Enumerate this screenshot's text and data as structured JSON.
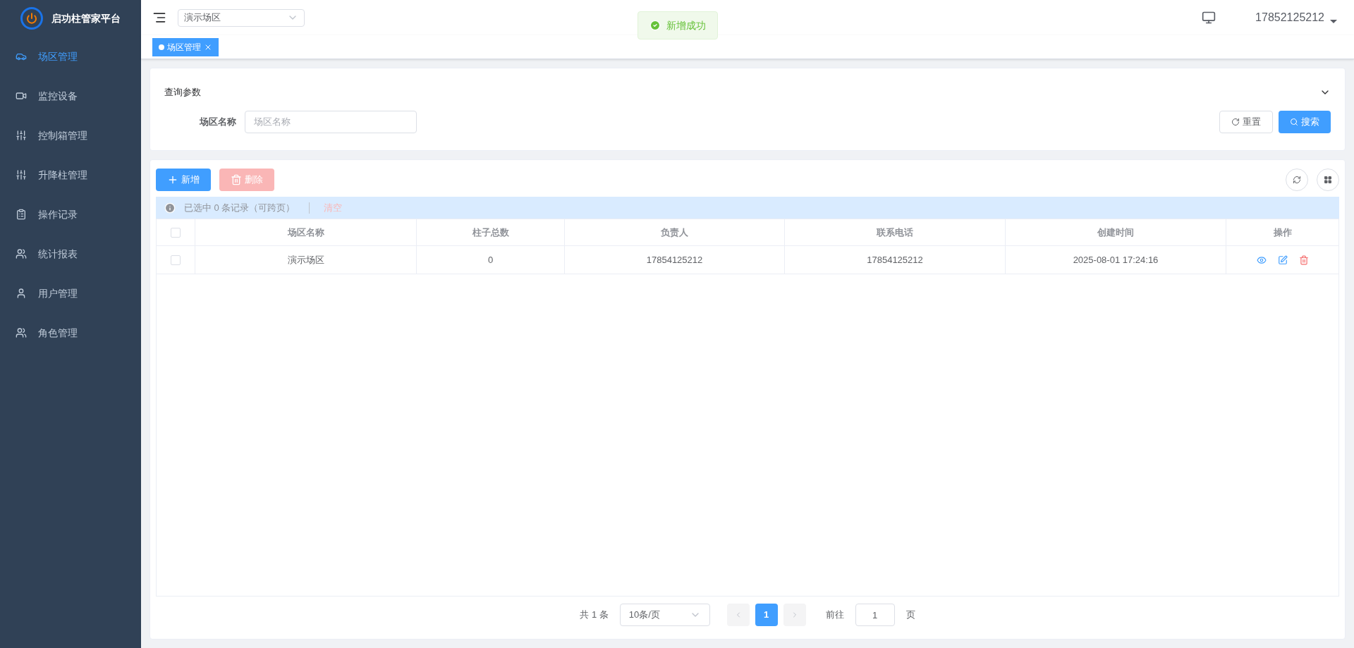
{
  "sidebar": {
    "title": "启功柱管家平台",
    "items": [
      {
        "label": "场区管理",
        "kind": "parking",
        "selected": true
      },
      {
        "label": "监控设备",
        "kind": "camera",
        "selected": false
      },
      {
        "label": "控制箱管理",
        "kind": "sliders",
        "selected": false
      },
      {
        "label": "升降柱管理",
        "kind": "sliders",
        "selected": false
      },
      {
        "label": "操作记录",
        "kind": "records",
        "selected": false
      },
      {
        "label": "统计报表",
        "kind": "stats",
        "selected": false
      },
      {
        "label": "用户管理",
        "kind": "user",
        "selected": false
      },
      {
        "label": "角色管理",
        "kind": "users",
        "selected": false
      }
    ]
  },
  "topbar": {
    "site_select": "演示场区",
    "toast": "新增成功",
    "user": "17852125212"
  },
  "tabs": [
    {
      "label": "场区管理",
      "selected": true
    }
  ],
  "query": {
    "title": "查询参数",
    "fields": [
      {
        "label": "场区名称",
        "placeholder": "场区名称"
      }
    ],
    "reset": "重置",
    "search": "搜索"
  },
  "toolbar": {
    "add": "新增",
    "delete": {
      "label": "删除",
      "disabled": true
    }
  },
  "selection_bar": {
    "text": "已选中 0 条记录（可跨页）",
    "clear": "清空"
  },
  "table": {
    "columns": [
      "场区名称",
      "柱子总数",
      "负责人",
      "联系电话",
      "创建时间",
      "操作"
    ],
    "all_checked": false,
    "rows": [
      {
        "checked": false,
        "cells": [
          "演示场区",
          "0",
          "17854125212",
          "17854125212",
          "2025-08-01 17:24:16"
        ]
      }
    ]
  },
  "pagination": {
    "total": "共 1 条",
    "page_size": "10条/页",
    "pages": [
      {
        "label": "1",
        "selected": true
      }
    ],
    "goto_label": "前往",
    "goto_value": "1",
    "page_suffix": "页"
  }
}
